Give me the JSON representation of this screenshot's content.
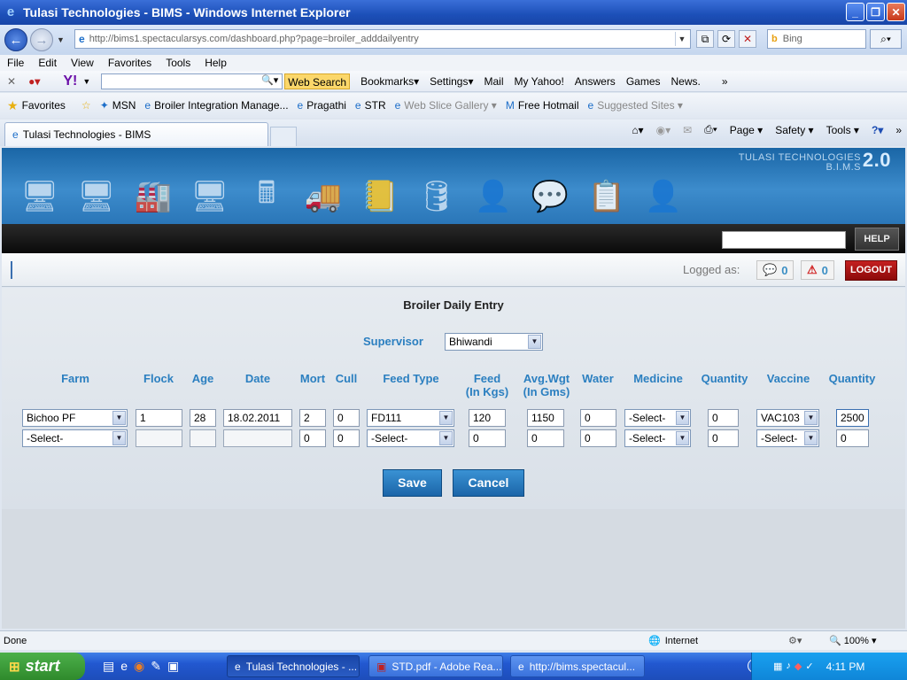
{
  "window": {
    "title": "Tulasi Technologies - BIMS - Windows Internet Explorer"
  },
  "address": {
    "url": "http://bims1.spectacularsys.com/dashboard.php?page=broiler_adddailyentry",
    "search_placeholder": "Bing"
  },
  "menu": [
    "File",
    "Edit",
    "View",
    "Favorites",
    "Tools",
    "Help"
  ],
  "yahoo_toolbar": {
    "web_search": "Web Search",
    "items": [
      "Bookmarks▾",
      "Settings▾",
      "Mail",
      "My Yahoo!",
      "Answers",
      "Games",
      "News."
    ]
  },
  "favorites_bar": {
    "favorites_label": "Favorites",
    "items": [
      "MSN",
      "Broiler Integration Manage...",
      "Pragathi",
      "STR",
      "Web Slice Gallery",
      "Free Hotmail",
      "Suggested Sites"
    ]
  },
  "tab": {
    "title": "Tulasi Technologies - BIMS"
  },
  "command_bar": [
    "Page",
    "Safety",
    "Tools"
  ],
  "app": {
    "brand_line1": "TULASI TECHNOLOGIES",
    "brand_line2": "B.I.M.S",
    "brand_version": "2.0",
    "help_label": "HELP",
    "logged_as_label": "Logged as:",
    "messages_count": "0",
    "alerts_count": "0",
    "logout_label": "LOGOUT",
    "nav_icons": [
      "monitor-icon",
      "monitor-icon",
      "factory-icon",
      "monitor-icon",
      "calculator-icon",
      "truck-icon",
      "ledger-icon",
      "database-add-icon",
      "user-icon",
      "chat-icon",
      "report-icon",
      "user-icon"
    ]
  },
  "form": {
    "title": "Broiler Daily Entry",
    "supervisor_label": "Supervisor",
    "supervisor_value": "Bhiwandi",
    "columns": [
      "Farm",
      "Flock",
      "Age",
      "Date",
      "Mort",
      "Cull",
      "Feed Type",
      "Feed\n(In Kgs)",
      "Avg.Wgt\n(In Gms)",
      "Water",
      "Medicine",
      "Quantity",
      "Vaccine",
      "Quantity"
    ],
    "rows": [
      {
        "farm": "Bichoo PF",
        "flock": "1",
        "age": "28",
        "date": "18.02.2011",
        "mort": "2",
        "cull": "0",
        "feed_type": "FD111",
        "feed": "120",
        "avg_wgt": "1150",
        "water": "0",
        "medicine": "-Select-",
        "med_qty": "0",
        "vaccine": "VAC103",
        "vac_qty": "2500"
      },
      {
        "farm": "-Select-",
        "flock": "",
        "age": "",
        "date": "",
        "mort": "0",
        "cull": "0",
        "feed_type": "-Select-",
        "feed": "0",
        "avg_wgt": "0",
        "water": "0",
        "medicine": "-Select-",
        "med_qty": "0",
        "vaccine": "-Select-",
        "vac_qty": "0"
      }
    ],
    "save_label": "Save",
    "cancel_label": "Cancel"
  },
  "ie_status": {
    "text": "Done",
    "zone": "Internet",
    "zoom": "100%"
  },
  "taskbar": {
    "start_label": "start",
    "tasks": [
      "Tulasi Technologies - ...",
      "STD.pdf - Adobe Rea...",
      "http://bims.spectacul..."
    ],
    "clock": "4:11 PM"
  }
}
